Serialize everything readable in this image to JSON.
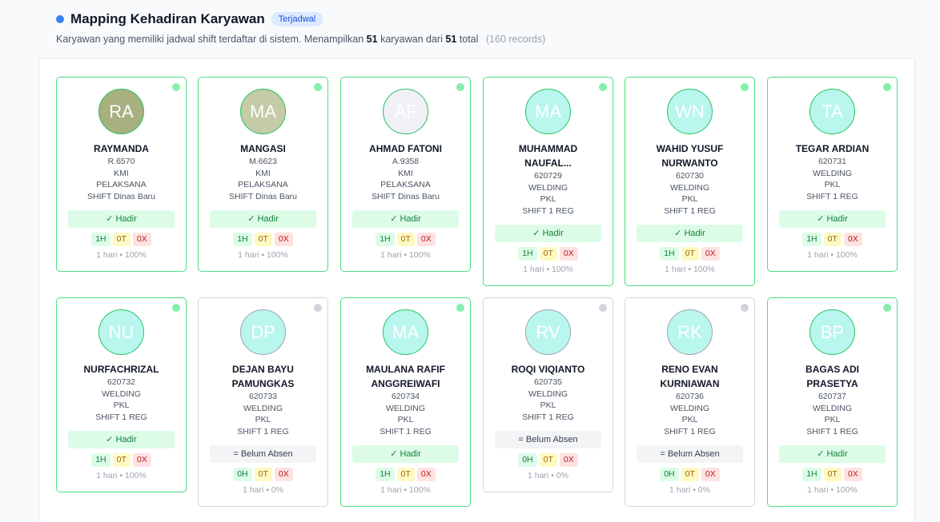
{
  "header": {
    "title": "Mapping Kehadiran Karyawan",
    "badge": "Terjadwal",
    "subtitle_pre": "Karyawan yang memiliki jadwal shift terdaftar di sistem. Menampilkan",
    "shown": "51",
    "subtitle_mid": "karyawan dari",
    "total": "51",
    "subtitle_post": "total",
    "records": "(160 records)"
  },
  "employees": [
    {
      "initials": "RA",
      "name": "RAYMANDA",
      "name2": "",
      "id": "R.6570",
      "company": "KMI",
      "position": "PELAKSANA",
      "shift": "SHIFT Dinas Baru",
      "status": "✓ Hadir",
      "h": "1H",
      "o": "0T",
      "x": "0X",
      "foot": "1 hari • 100%",
      "avatar_color": "#a8b080",
      "online": true
    },
    {
      "initials": "MA",
      "name": "MANGASI",
      "name2": "",
      "id": "M.6623",
      "company": "KMI",
      "position": "PELAKSANA",
      "shift": "SHIFT Dinas Baru",
      "status": "✓ Hadir",
      "h": "1H",
      "o": "0T",
      "x": "0X",
      "foot": "1 hari • 100%",
      "avatar_color": "#c4cba6",
      "online": true
    },
    {
      "initials": "AF",
      "name": "AHMAD FATONI",
      "name2": "",
      "id": "A.9358",
      "company": "KMI",
      "position": "PELAKSANA",
      "shift": "SHIFT Dinas Baru",
      "status": "✓ Hadir",
      "h": "1H",
      "o": "0T",
      "x": "0X",
      "foot": "1 hari • 100%",
      "avatar_color": "#f1f0f7",
      "online": true
    },
    {
      "initials": "MA",
      "name": "MUHAMMAD",
      "name2": "NAUFAL...",
      "id": "620729",
      "company": "WELDING",
      "position": "PKL",
      "shift": "SHIFT 1 REG",
      "status": "✓ Hadir",
      "h": "1H",
      "o": "0T",
      "x": "0X",
      "foot": "1 hari • 100%",
      "avatar_color": "#b9f6ee",
      "online": true
    },
    {
      "initials": "WN",
      "name": "WAHID YUSUF",
      "name2": "NURWANTO",
      "id": "620730",
      "company": "WELDING",
      "position": "PKL",
      "shift": "SHIFT 1 REG",
      "status": "✓ Hadir",
      "h": "1H",
      "o": "0T",
      "x": "0X",
      "foot": "1 hari • 100%",
      "avatar_color": "#b9f6ee",
      "online": true
    },
    {
      "initials": "TA",
      "name": "TEGAR ARDIAN",
      "name2": "",
      "id": "620731",
      "company": "WELDING",
      "position": "PKL",
      "shift": "SHIFT 1 REG",
      "status": "✓ Hadir",
      "h": "1H",
      "o": "0T",
      "x": "0X",
      "foot": "1 hari • 100%",
      "avatar_color": "#b9f6ee",
      "online": true
    },
    {
      "initials": "NU",
      "name": "NURFACHRIZAL",
      "name2": "",
      "id": "620732",
      "company": "WELDING",
      "position": "PKL",
      "shift": "SHIFT 1 REG",
      "status": "✓ Hadir",
      "h": "1H",
      "o": "0T",
      "x": "0X",
      "foot": "1 hari • 100%",
      "avatar_color": "#b9f6ee",
      "online": true
    },
    {
      "initials": "DP",
      "name": "DEJAN BAYU",
      "name2": "PAMUNGKAS",
      "id": "620733",
      "company": "WELDING",
      "position": "PKL",
      "shift": "SHIFT 1 REG",
      "status": "= Belum Absen",
      "h": "0H",
      "o": "0T",
      "x": "0X",
      "foot": "1 hari • 0%",
      "avatar_color": "#b9f6ee",
      "online": false
    },
    {
      "initials": "MA",
      "name": "MAULANA RAFIF",
      "name2": "ANGGREIWAFI",
      "id": "620734",
      "company": "WELDING",
      "position": "PKL",
      "shift": "SHIFT 1 REG",
      "status": "✓ Hadir",
      "h": "1H",
      "o": "0T",
      "x": "0X",
      "foot": "1 hari • 100%",
      "avatar_color": "#b9f6ee",
      "online": true
    },
    {
      "initials": "RV",
      "name": "ROQI VIQIANTO",
      "name2": "",
      "id": "620735",
      "company": "WELDING",
      "position": "PKL",
      "shift": "SHIFT 1 REG",
      "status": "= Belum Absen",
      "h": "0H",
      "o": "0T",
      "x": "0X",
      "foot": "1 hari • 0%",
      "avatar_color": "#b9f6ee",
      "online": false
    },
    {
      "initials": "RK",
      "name": "RENO EVAN",
      "name2": "KURNIAWAN",
      "id": "620736",
      "company": "WELDING",
      "position": "PKL",
      "shift": "SHIFT 1 REG",
      "status": "= Belum Absen",
      "h": "0H",
      "o": "0T",
      "x": "0X",
      "foot": "1 hari • 0%",
      "avatar_color": "#b9f6ee",
      "online": false
    },
    {
      "initials": "BP",
      "name": "BAGAS ADI",
      "name2": "PRASETYA",
      "id": "620737",
      "company": "WELDING",
      "position": "PKL",
      "shift": "SHIFT 1 REG",
      "status": "✓ Hadir",
      "h": "1H",
      "o": "0T",
      "x": "0X",
      "foot": "1 hari • 100%",
      "avatar_color": "#b9f6ee",
      "online": true
    }
  ]
}
